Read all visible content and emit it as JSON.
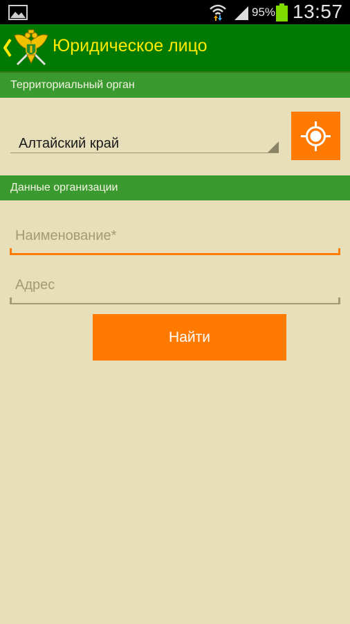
{
  "status_bar": {
    "battery_percent": "95%",
    "time": "13:57",
    "icons": [
      "gallery-icon",
      "wifi-icon",
      "signal-icon",
      "battery-icon"
    ]
  },
  "action_bar": {
    "title": "Юридическое лицо",
    "icons": [
      "back-chevron-icon",
      "emblem-icon"
    ]
  },
  "sections": {
    "territorial": {
      "header": "Территориальный орган",
      "region_value": "Алтайский край",
      "locate_icon": "target-icon"
    },
    "organization": {
      "header": "Данные организации",
      "name_placeholder": "Наименование*",
      "name_value": "",
      "address_placeholder": "Адрес",
      "address_value": ""
    }
  },
  "search_button": {
    "label": "Найти"
  },
  "colors": {
    "background": "#e6dfb9",
    "action_bar": "#007a00",
    "title": "#ffea00",
    "section_header": "#3b9a2f",
    "accent": "#ff7a00",
    "hint": "#a39b72"
  }
}
